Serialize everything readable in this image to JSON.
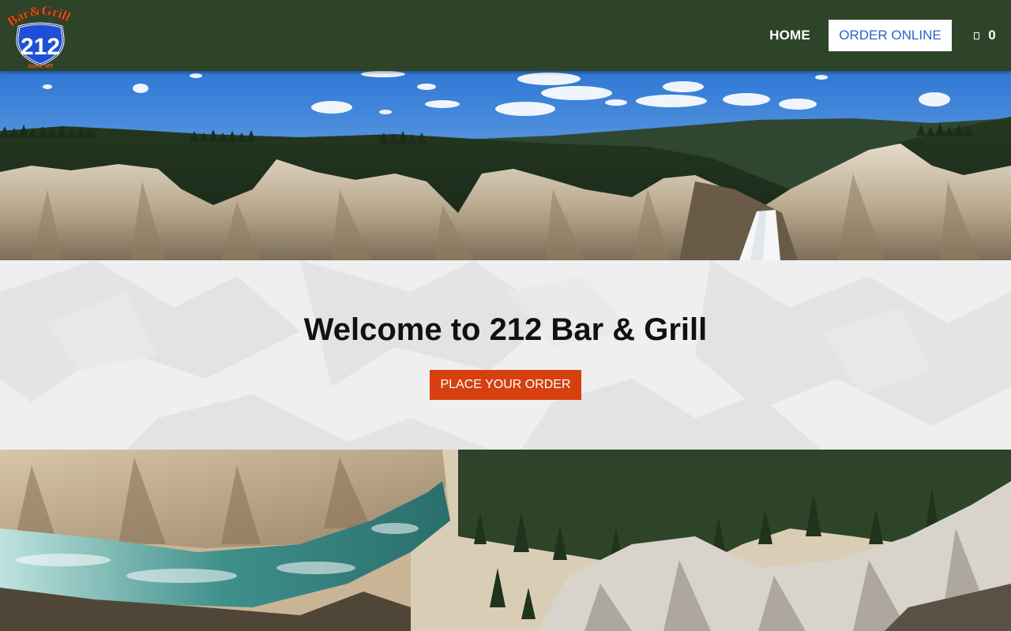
{
  "header": {
    "logo": {
      "text_top": "Bar&Grill",
      "number": "212",
      "location": "Joliet, MT"
    },
    "nav": {
      "home_label": "HOME",
      "order_online_label": "ORDER ONLINE"
    },
    "cart": {
      "icon": "cart-icon",
      "count": "0"
    }
  },
  "hero": {
    "title": "Welcome to 212 Bar & Grill",
    "cta_label": "PLACE YOUR ORDER"
  },
  "colors": {
    "header_bg": "#2e4429",
    "order_online_text": "#2a64c9",
    "cta_bg": "#d6400f",
    "logo_orange": "#e8581c",
    "logo_blue": "#1f4fd6"
  }
}
